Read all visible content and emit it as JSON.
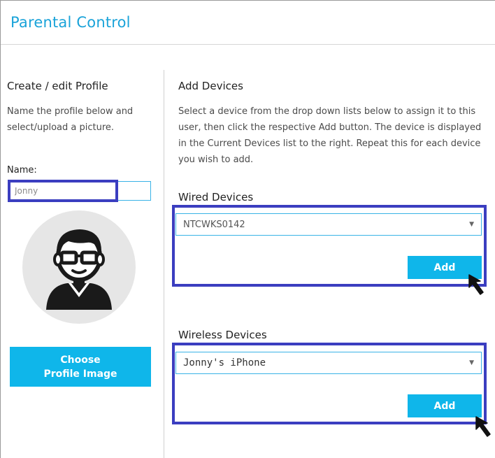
{
  "header": {
    "title": "Parental Control"
  },
  "profile": {
    "heading": "Create / edit Profile",
    "description": "Name the profile below and select/upload a picture.",
    "name_label": "Name:",
    "name_value": "Jonny",
    "avatar_icon": "user-with-glasses-icon",
    "choose_button_line1": "Choose",
    "choose_button_line2": "Profile Image"
  },
  "devices": {
    "heading": "Add Devices",
    "description": "Select a device from the drop down lists below to assign it to this user, then click the respective Add button. The device is displayed in the Current Devices list to the right. Repeat this for each device you wish to add.",
    "wired": {
      "label": "Wired Devices",
      "selected": "NTCWKS0142",
      "add_label": "Add"
    },
    "wireless": {
      "label": "Wireless Devices",
      "selected": "Jonny's iPhone",
      "add_label": "Add"
    }
  },
  "colors": {
    "accent": "#0fb6ea",
    "title": "#1aa3d9",
    "highlight": "#3b3ec0"
  }
}
